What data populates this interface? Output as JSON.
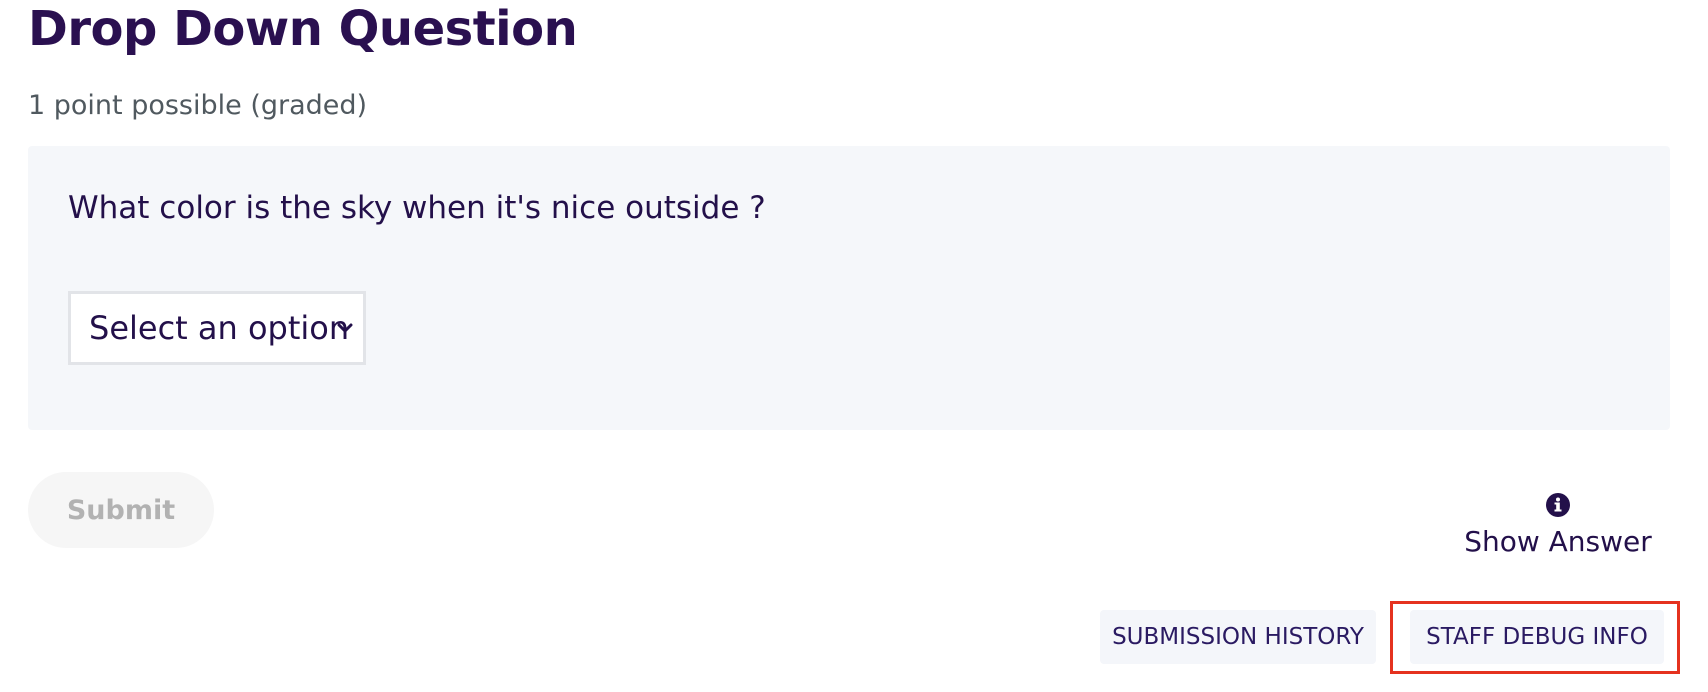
{
  "problem": {
    "title": "Drop Down Question",
    "points": "1 point possible (graded)",
    "question": "What color is the sky when it's nice outside ?"
  },
  "dropdown": {
    "selected": "Select an option",
    "icon": "chevron-down-icon"
  },
  "actions": {
    "submit_label": "Submit",
    "show_answer_label": "Show Answer",
    "show_answer_icon": "info-icon"
  },
  "staff_buttons": {
    "submission_history": "SUBMISSION HISTORY",
    "staff_debug_info": "STAFF DEBUG INFO"
  },
  "colors": {
    "title": "#2a1050",
    "text": "#23104a",
    "muted": "#50595f",
    "panel_bg": "#f5f7fa",
    "highlight": "#e5321f",
    "disabled_text": "#b2b2b2"
  }
}
